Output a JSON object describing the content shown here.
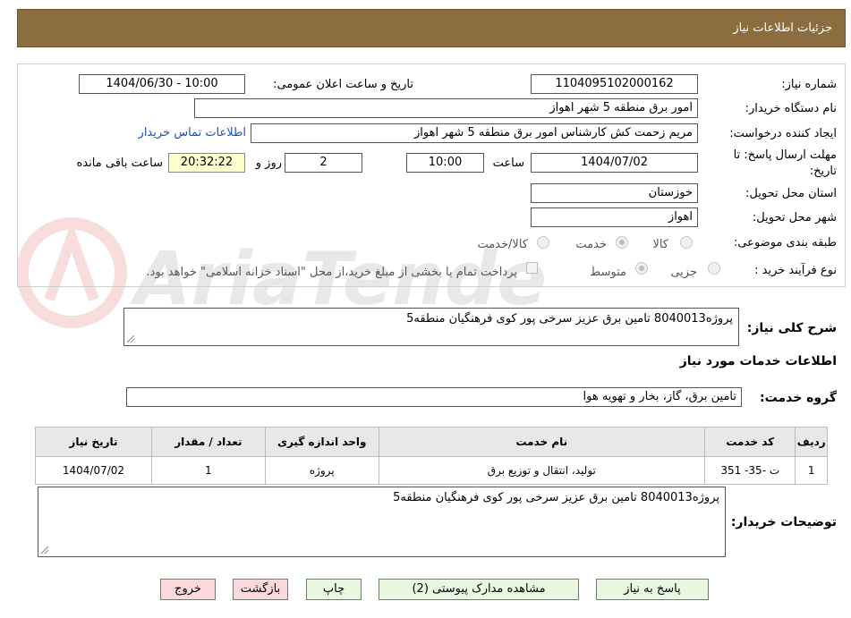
{
  "header": {
    "title": "جزئیات اطلاعات نیاز"
  },
  "form": {
    "need_number": {
      "label": "شماره نیاز:",
      "value": "1104095102000162"
    },
    "announce_datetime": {
      "label": "تاریخ و ساعت اعلان عمومی:",
      "value": "1404/06/30 - 10:00"
    },
    "buyer_org": {
      "label": "نام دستگاه خریدار:",
      "value": "امور برق منطقه 5 شهر اهواز"
    },
    "creator": {
      "label": "ایجاد کننده درخواست:",
      "value": "مریم زحمت کش کارشناس امور برق منطقه 5 شهر اهواز",
      "contact_link": "اطلاعات تماس خریدار"
    },
    "deadline": {
      "label_line1": "مهلت ارسال پاسخ: تا",
      "label_line2": "تاریخ:",
      "date": "1404/07/02",
      "time_label": "ساعت",
      "time": "10:00",
      "days": "2",
      "days_label": "روز و",
      "remaining": "20:32:22",
      "remaining_label": "ساعت باقی مانده"
    },
    "province": {
      "label": "استان محل تحویل:",
      "value": "خوزستان"
    },
    "city": {
      "label": "شهر محل تحویل:",
      "value": "اهواز"
    },
    "category": {
      "label": "طبقه بندی موضوعی:",
      "options": [
        "کالا",
        "خدمت",
        "کالا/خدمت"
      ],
      "selected": "خدمت"
    },
    "purchase_type": {
      "label": "نوع فرآیند خرید :",
      "options": [
        "جزیی",
        "متوسط"
      ],
      "selected": "متوسط",
      "payment_note": "پرداخت تمام یا بخشی از مبلغ خرید،از محل \"اسناد خزانه اسلامی\" خواهد بود."
    }
  },
  "summary": {
    "label": "شرح کلی نیاز:",
    "value": "پروژه8040013 تامین برق عزیز سرخی پور کوی فرهنگیان منطقه5"
  },
  "services_section": {
    "title": "اطلاعات خدمات مورد نیاز"
  },
  "service_group": {
    "label": "گروه خدمت:",
    "value": "تامین برق، گاز، بخار و تهویه هوا"
  },
  "table": {
    "headers": [
      "ردیف",
      "کد خدمت",
      "نام خدمت",
      "واحد اندازه گیری",
      "تعداد / مقدار",
      "تاریخ نیاز"
    ],
    "rows": [
      [
        "1",
        "ت -35- 351",
        "تولید، انتقال و توزیع برق",
        "پروژه",
        "1",
        "1404/07/02"
      ]
    ]
  },
  "buyer_notes": {
    "label": "توضیحات خریدار:",
    "value": "پروژه8040013 تامین برق عزیز سرخی پور کوی فرهنگیان منطقه5"
  },
  "buttons": {
    "reply": "پاسخ به نیاز",
    "attachments": "مشاهده مدارک پیوستی (2)",
    "print": "چاپ",
    "back": "بازگشت",
    "exit": "خروج"
  },
  "watermark_text": "AriaTender.neT",
  "colors": {
    "header_bg": "#8b6d3f",
    "green_btn": "#e8f7e0",
    "pink_btn": "#fbd8dc",
    "time_box": "#ffffcc",
    "link": "#1a4fc4"
  }
}
